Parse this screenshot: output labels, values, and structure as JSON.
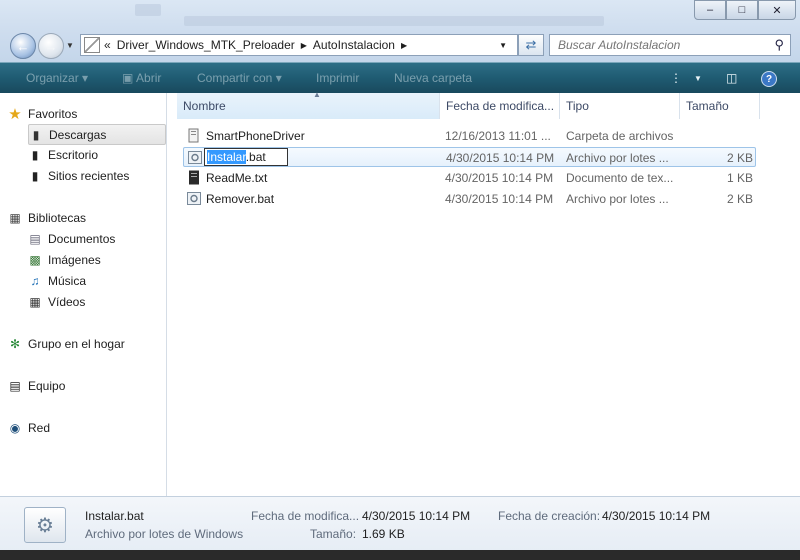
{
  "window": {
    "title_bar": {
      "buttons": [
        "minimize",
        "maximize",
        "close"
      ]
    }
  },
  "address": {
    "overflow": "«",
    "crumbs": [
      "Driver_Windows_MTK_Preloader",
      "AutoInstalacion"
    ]
  },
  "search": {
    "placeholder": "Buscar AutoInstalacion"
  },
  "toolbar": {
    "organize": "Organizar ▾",
    "open": "Abrir",
    "share": "Compartir con ▾",
    "print": "Imprimir",
    "new_folder": "Nueva carpeta",
    "help": "?"
  },
  "nav": {
    "favorites": "Favoritos",
    "downloads": "Descargas",
    "desktop": "Escritorio",
    "recent": "Sitios recientes",
    "libraries": "Bibliotecas",
    "documents": "Documentos",
    "images": "Imágenes",
    "music": "Música",
    "videos": "Vídeos",
    "homegroup": "Grupo en el hogar",
    "computer": "Equipo",
    "network": "Red"
  },
  "columns": {
    "name": "Nombre",
    "date": "Fecha de modifica...",
    "type": "Tipo",
    "size": "Tamaño"
  },
  "files": [
    {
      "name": "SmartPhoneDriver",
      "date": "12/16/2013 11:01 ...",
      "type": "Carpeta de archivos",
      "size": "",
      "icon": "folder-icon"
    },
    {
      "name": "Instalar.bat",
      "name_selected": "Instalar",
      "name_ext": ".bat",
      "date": "4/30/2015 10:14 PM",
      "type": "Archivo por lotes ...",
      "size": "2 KB",
      "icon": "batch-file-icon"
    },
    {
      "name": "ReadMe.txt",
      "date": "4/30/2015 10:14 PM",
      "type": "Documento de tex...",
      "size": "1 KB",
      "icon": "text-file-icon"
    },
    {
      "name": "Remover.bat",
      "date": "4/30/2015 10:14 PM",
      "type": "Archivo por lotes ...",
      "size": "2 KB",
      "icon": "batch-file-icon"
    }
  ],
  "details": {
    "name": "Instalar.bat",
    "kind": "Archivo por lotes de Windows",
    "modified_label": "Fecha de modifica...",
    "modified_value": "4/30/2015 10:14 PM",
    "created_label": "Fecha de creación:",
    "created_value": "4/30/2015 10:14 PM",
    "size_label": "Tamaño:",
    "size_value": "1.69 KB"
  }
}
